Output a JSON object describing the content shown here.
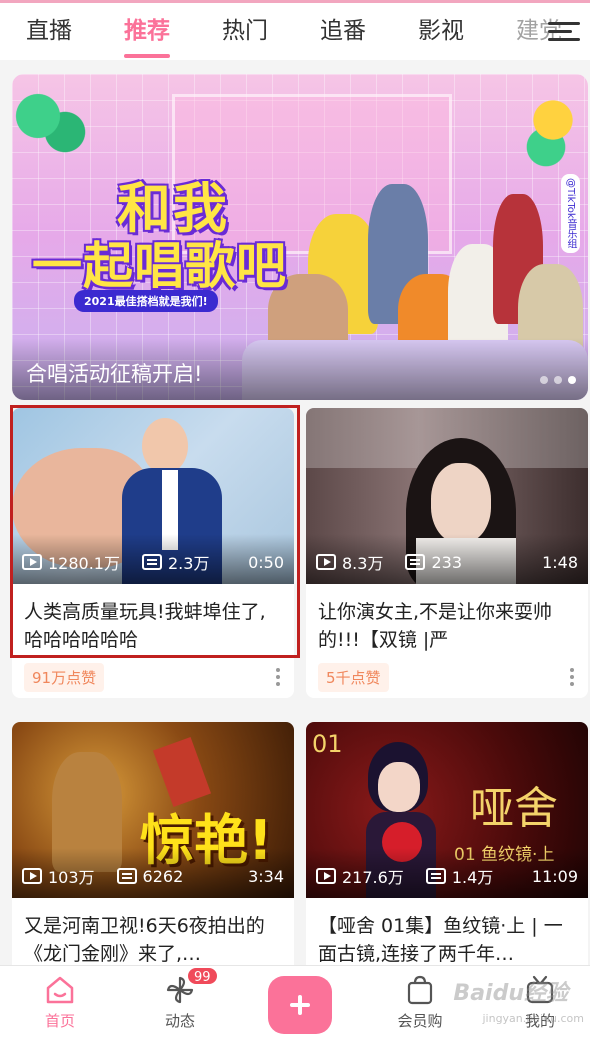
{
  "tabs": [
    {
      "label": "直播",
      "active": false
    },
    {
      "label": "推荐",
      "active": true
    },
    {
      "label": "热门",
      "active": false
    },
    {
      "label": "追番",
      "active": false
    },
    {
      "label": "影视",
      "active": false
    },
    {
      "label": "建党",
      "active": false
    }
  ],
  "banner": {
    "logo_line1": "和我",
    "logo_line2": "一起唱歌吧",
    "logo_sub": "2021最佳搭档就是我们!",
    "side_label": "@TikTok音乐组",
    "caption": "合唱活动征稿开启!",
    "page_count": 3,
    "current_page": 3
  },
  "cards": [
    {
      "views": "1280.1万",
      "danmaku": "2.3万",
      "duration": "0:50",
      "title": "人类高质量玩具!我蚌埠住了,哈哈哈哈哈哈",
      "tag": "91万点赞"
    },
    {
      "views": "8.3万",
      "danmaku": "233",
      "duration": "1:48",
      "title": "让你演女主,不是让你来耍帅的!!!【双镜 |严",
      "tag": "5千点赞"
    },
    {
      "views": "103万",
      "danmaku": "6262",
      "duration": "3:34",
      "title": "又是河南卫视!6天6夜拍出的《龙门金刚》来了,…",
      "thumb_text": "惊艳!"
    },
    {
      "views": "217.6万",
      "danmaku": "1.4万",
      "duration": "11:09",
      "title": "【哑舍 01集】鱼纹镜·上 | 一面古镜,连接了两千年…",
      "thumb_text": "哑舍",
      "thumb_sub": "01 鱼纹镜·上",
      "thumb_ep": "01"
    }
  ],
  "nav": {
    "home": "首页",
    "dynamic": "动态",
    "dynamic_badge": "99",
    "shop": "会员购",
    "mine": "我的"
  },
  "watermark": {
    "brand": "Baidu经验",
    "url": "jingyan.baidu.com"
  },
  "colors": {
    "accent": "#fb7299",
    "highlight_box": "#c0201f",
    "tag_text": "#f0875c"
  }
}
